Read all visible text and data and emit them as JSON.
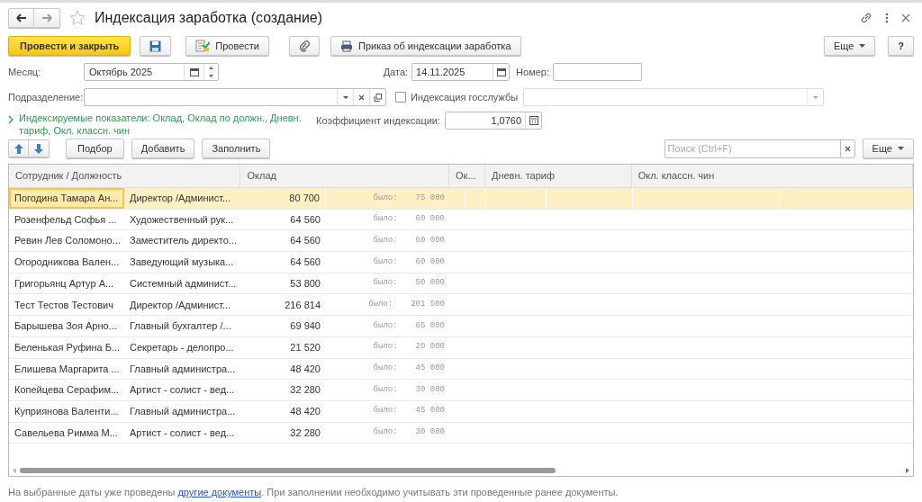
{
  "window": {
    "title": "Индексация заработка (создание)"
  },
  "toolbar": {
    "post_close": "Провести и закрыть",
    "post": "Провести",
    "print": "Приказ об индексации заработка",
    "more": "Еще",
    "help": "?"
  },
  "fields": {
    "month_label": "Месяц:",
    "month": "Октябрь 2025",
    "date_label": "Дата:",
    "date": "14.11.2025",
    "number_label": "Номер:",
    "dept_label": "Подразделение:",
    "civil_label": "Индексация госслужбы",
    "civil_checked": false,
    "indicators": "Индексируемые показатели: Оклад, Оклад по должн., Дневн. тариф, Окл. классн. чин",
    "coef_label": "Коэффициент индексации:",
    "coef": "1,0760"
  },
  "table_toolbar": {
    "pick": "Подбор",
    "add": "Добавить",
    "fill": "Заполнить",
    "search_placeholder": "Поиск (Ctrl+F)",
    "more": "Еще"
  },
  "table": {
    "columns": [
      "Сотрудник / Должность",
      "Оклад",
      "Ок...",
      "Дневн. тариф",
      "Окл. классн. чин"
    ],
    "rows": [
      {
        "name": "Погодина Тамара Ан...",
        "position": "Директор /Админист...",
        "salary": "80 700",
        "was_label": "было:",
        "was": "75 000",
        "selected": true
      },
      {
        "name": "Розенфельд Софья ...",
        "position": "Художественный рук...",
        "salary": "64 560",
        "was_label": "было:",
        "was": "60 000",
        "selected": false
      },
      {
        "name": "Ревин Лев Соломоно...",
        "position": "Заместитель директо...",
        "salary": "64 560",
        "was_label": "было:",
        "was": "60 000",
        "selected": false
      },
      {
        "name": "Огородникова Вален...",
        "position": "Заведующий музыка...",
        "salary": "64 560",
        "was_label": "было:",
        "was": "60 000",
        "selected": false
      },
      {
        "name": "Григорьянц Артур А...",
        "position": "Системный админист...",
        "salary": "53 800",
        "was_label": "было:",
        "was": "50 000",
        "selected": false
      },
      {
        "name": "Тест Тестов Тестович",
        "position": "Директор /Админист...",
        "salary": "216 814",
        "was_label": "было:",
        "was": "201 500",
        "selected": false
      },
      {
        "name": "Барышева Зоя Арно...",
        "position": "Главный бухгалтер /...",
        "salary": "69 940",
        "was_label": "было:",
        "was": "65 000",
        "selected": false
      },
      {
        "name": "Беленькая Руфина Б...",
        "position": "Секретарь - делопро...",
        "salary": "21 520",
        "was_label": "было:",
        "was": "20 000",
        "selected": false
      },
      {
        "name": "Елишева Маргарита ...",
        "position": "Главный администра...",
        "salary": "48 420",
        "was_label": "было:",
        "was": "45 000",
        "selected": false
      },
      {
        "name": "Копейцева Серафим...",
        "position": "Артист - солист - вед...",
        "salary": "32 280",
        "was_label": "было:",
        "was": "30 000",
        "selected": false
      },
      {
        "name": "Куприянова Валенти...",
        "position": "Главный администра...",
        "salary": "48 420",
        "was_label": "было:",
        "was": "45 000",
        "selected": false
      },
      {
        "name": "Савельева Римма М...",
        "position": "Артист - солист - вед...",
        "salary": "32 280",
        "was_label": "было:",
        "was": "30 000",
        "selected": false
      }
    ]
  },
  "footer": {
    "before": "На выбранные даты уже проведены ",
    "link": "другие документы",
    "after": ". При заполнении необходимо учитывать эти проведенные ранее документы."
  }
}
